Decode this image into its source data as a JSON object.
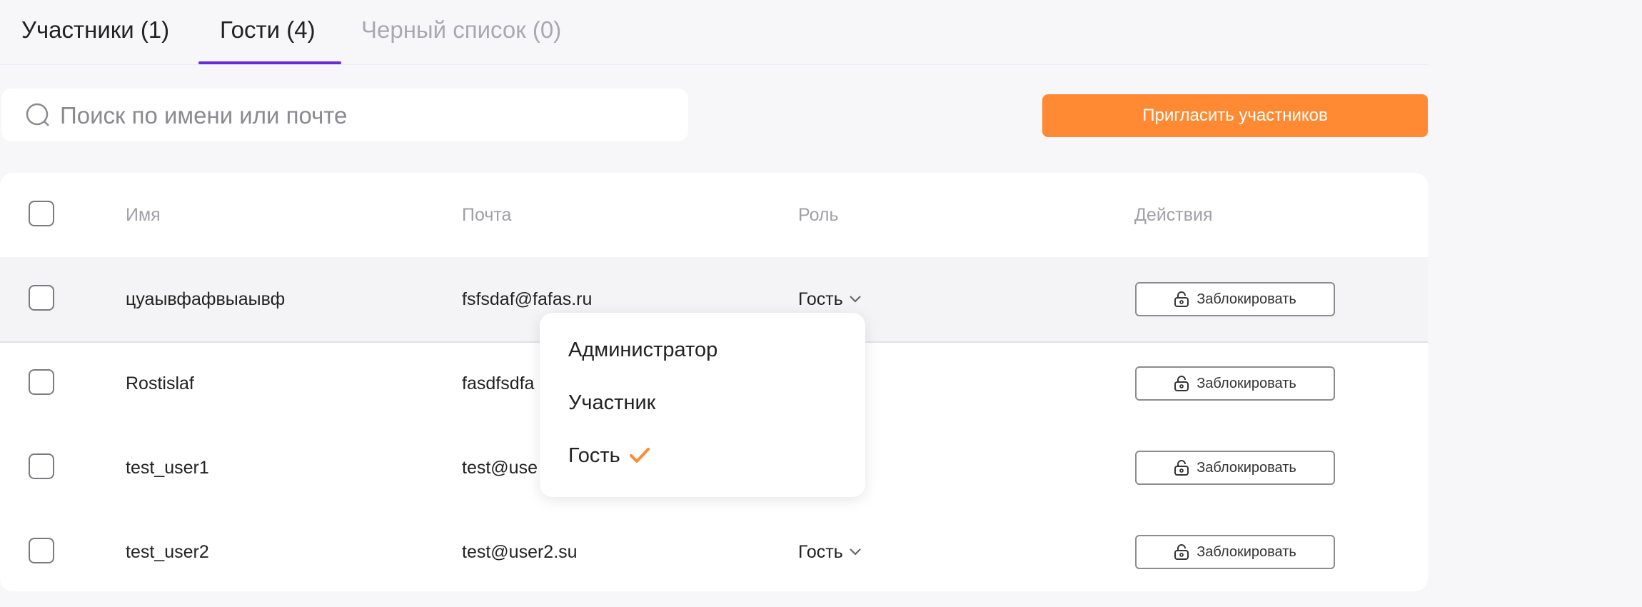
{
  "tabs": [
    {
      "label": "Участники (1)",
      "active": false
    },
    {
      "label": "Гости (4)",
      "active": true
    },
    {
      "label": "Черный список (0)",
      "active": false
    }
  ],
  "search": {
    "placeholder": "Поиск по имени или почте",
    "value": ""
  },
  "invite_button": "Пригласить участников",
  "table": {
    "headers": {
      "name": "Имя",
      "email": "Почта",
      "role": "Роль",
      "actions": "Действия"
    },
    "rows": [
      {
        "name": "цуаывфафвыаывф",
        "email": "fsfsdaf@fafas.ru",
        "role": "Гость",
        "action": "Заблокировать"
      },
      {
        "name": "Rostislaf",
        "email": "fasdfsdfa",
        "role": "",
        "action": "Заблокировать"
      },
      {
        "name": "test_user1",
        "email": "test@use",
        "role": "",
        "action": "Заблокировать"
      },
      {
        "name": "test_user2",
        "email": "test@user2.su",
        "role": "Гость",
        "action": "Заблокировать"
      }
    ]
  },
  "role_dropdown": {
    "options": [
      "Администратор",
      "Участник",
      "Гость"
    ],
    "selected": "Гость"
  },
  "colors": {
    "accent": "#ff8a33",
    "tab_underline": "#6b2bd9",
    "check": "#ff8a33"
  }
}
